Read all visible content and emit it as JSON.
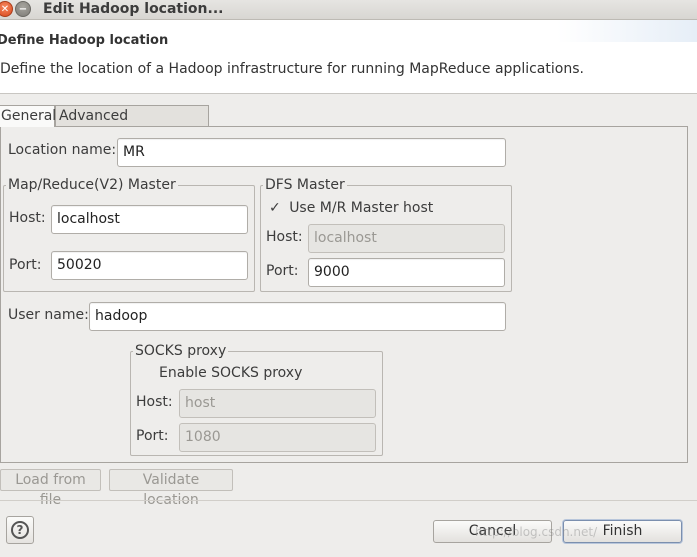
{
  "window": {
    "title": "Edit Hadoop location...",
    "close_glyph": "✕",
    "minimize_glyph": "−"
  },
  "header": {
    "title": "Define Hadoop location",
    "description": "Define the location of a Hadoop infrastructure for running MapReduce applications."
  },
  "tabs": [
    {
      "label": "General",
      "active": true
    },
    {
      "label": "Advanced parameters",
      "active": false
    }
  ],
  "general": {
    "location_name_label": "Location name:",
    "location_name_value": "MR",
    "mapreduce_group": {
      "title": "Map/Reduce(V2) Master",
      "host_label": "Host:",
      "host_value": "localhost",
      "port_label": "Port:",
      "port_value": "50020"
    },
    "dfs_group": {
      "title": "DFS Master",
      "use_mr_checkmark": "✓",
      "use_mr_label": "Use M/R Master host",
      "use_mr_checked": true,
      "host_label": "Host:",
      "host_value": "localhost",
      "port_label": "Port:",
      "port_value": "9000"
    },
    "user_name_label": "User name:",
    "user_name_value": "hadoop",
    "socks_group": {
      "title": "SOCKS proxy",
      "enable_label": "Enable SOCKS proxy",
      "enable_checked": false,
      "host_label": "Host:",
      "host_value": "host",
      "port_label": "Port:",
      "port_value": "1080"
    }
  },
  "actions": {
    "load_from_file": "Load from file",
    "validate_location": "Validate location"
  },
  "dialog": {
    "help_glyph": "?",
    "cancel": "Cancel",
    "finish": "Finish"
  },
  "watermark": "http://blog.csdn.net/"
}
